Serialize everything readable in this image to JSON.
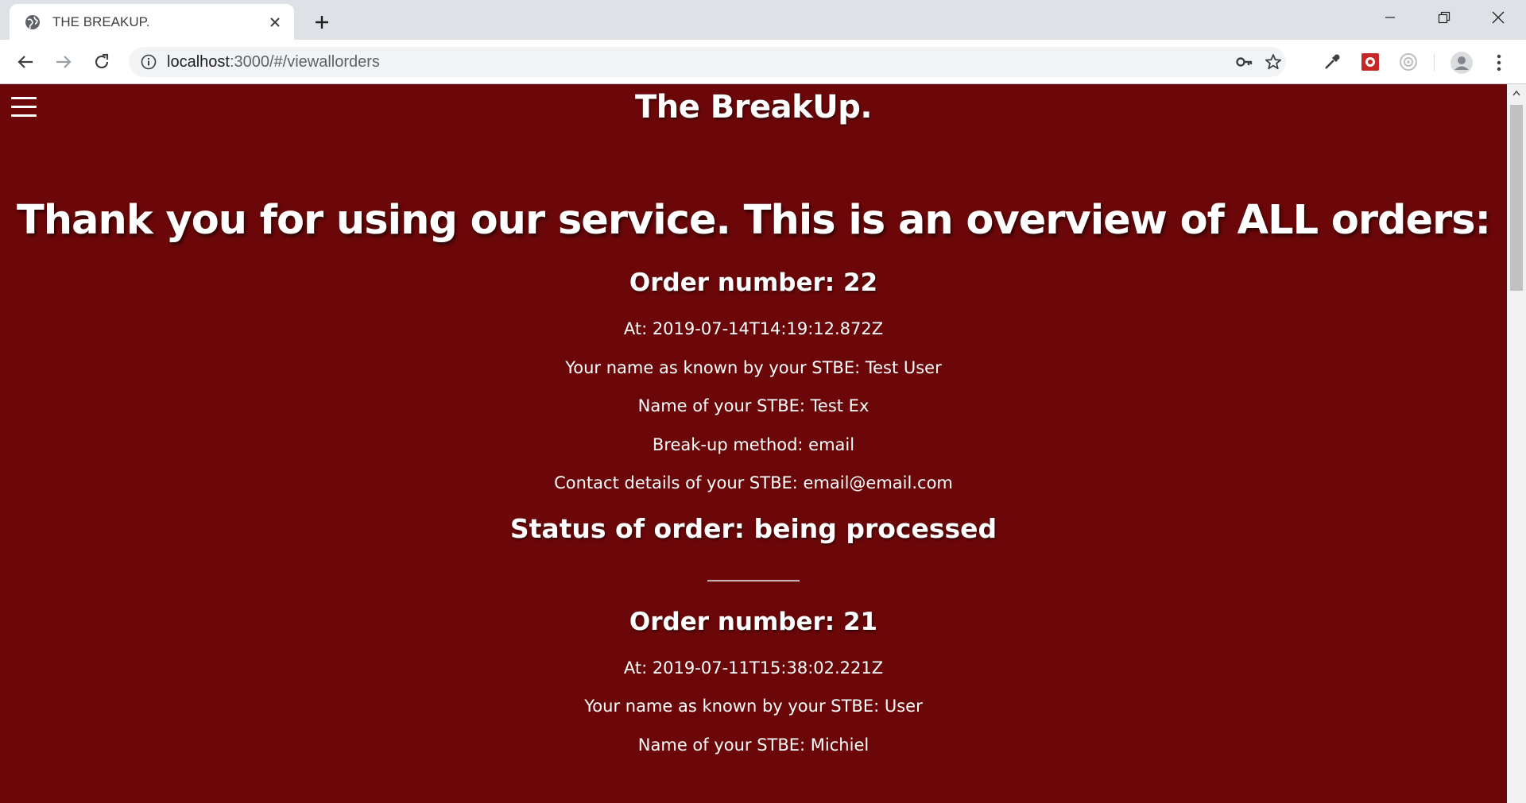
{
  "browser": {
    "tab_title": "THE BREAKUP.",
    "url_host": "localhost",
    "url_path": ":3000/#/viewallorders"
  },
  "page": {
    "site_title": "The BreakUp.",
    "heading": "Thank you for using our service. This is an overview of ALL orders:",
    "orders": [
      {
        "number": "Order number: 22",
        "at": "At: 2019-07-14T14:19:12.872Z",
        "your_name": "Your name as known by your STBE: Test User",
        "stbe_name": "Name of your STBE: Test Ex",
        "method": "Break-up method: email",
        "contact": "Contact details of your STBE: email@email.com",
        "status": "Status of order: being processed",
        "separator": "___________"
      },
      {
        "number": "Order number: 21",
        "at": "At: 2019-07-11T15:38:02.221Z",
        "your_name": "Your name as known by your STBE: User",
        "stbe_name": "Name of your STBE: Michiel"
      }
    ]
  },
  "icons": {
    "tab_favicon": "globe-icon",
    "tab_close": "close-icon",
    "new_tab": "plus-icon",
    "back": "arrow-left-icon",
    "forward": "arrow-right-icon",
    "reload": "reload-icon",
    "site_info": "info-icon",
    "password": "key-icon",
    "bookmark": "star-icon",
    "menu": "hamburger-icon"
  },
  "colors": {
    "page_background": "#6c0709",
    "text": "#ffffff"
  }
}
